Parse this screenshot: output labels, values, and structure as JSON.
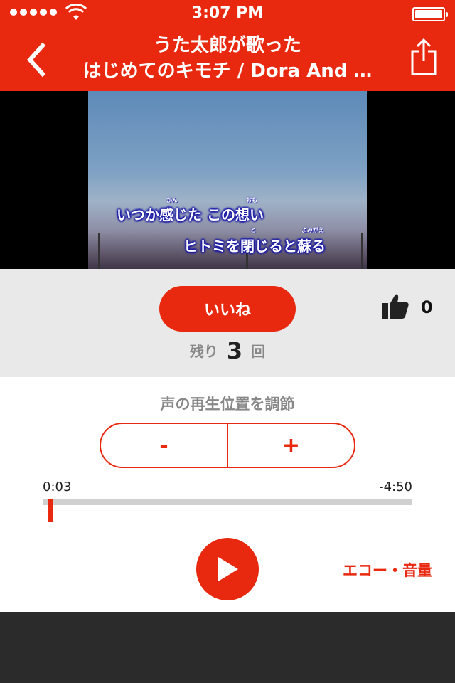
{
  "status_bar": {
    "time": "3:07 PM"
  },
  "header": {
    "title_line1": "うた太郎が歌った",
    "title_line2": "はじめてのキモチ / Dora And …"
  },
  "video": {
    "lyric_line1": "いつか感じた この想い",
    "lyric_line2": "ヒトミを閉じると蘇る",
    "ruby_kan": "かん",
    "ruby_omoi": "おも",
    "ruby_to": "と",
    "ruby_yomigaeru": "よみがえ"
  },
  "like": {
    "button_label": "いいね",
    "remaining_prefix": "残り",
    "remaining_count": "3",
    "remaining_suffix": "回",
    "like_count": "0"
  },
  "playback": {
    "adjust_label": "声の再生位置を調節",
    "minus_label": "-",
    "plus_label": "+",
    "current_time": "0:03",
    "remaining_time": "-4:50",
    "progress_fraction": 0.01,
    "echo_label": "エコー・音量"
  },
  "colors": {
    "accent": "#e8290f",
    "lyric_outline": "#1a1aa8"
  },
  "icons": [
    "back-chevron-icon",
    "share-icon",
    "thumbs-up-icon",
    "play-icon",
    "wifi-icon",
    "battery-icon"
  ]
}
